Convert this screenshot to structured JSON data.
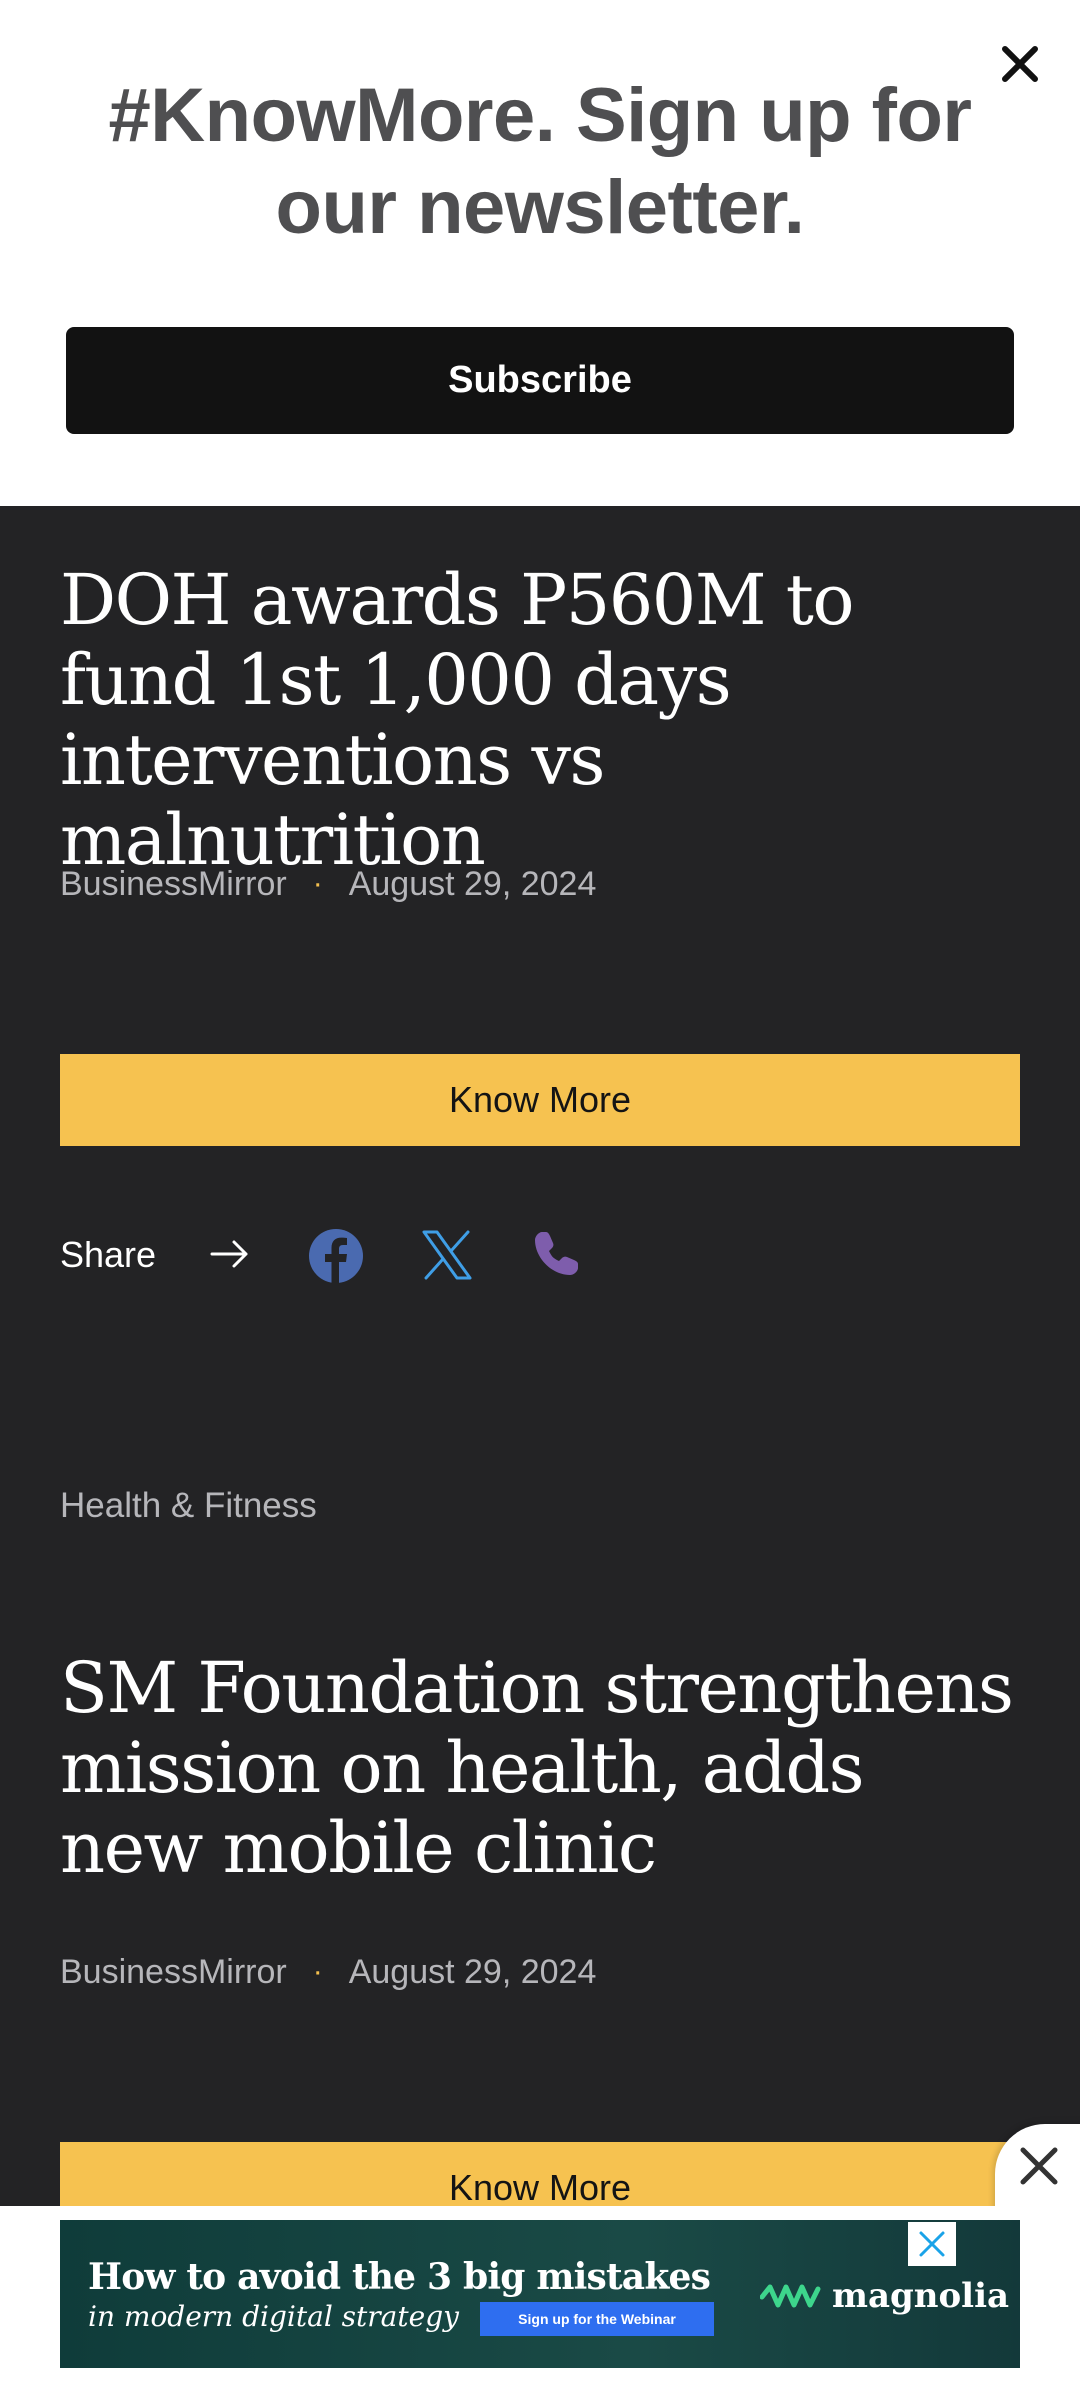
{
  "newsletter": {
    "title": "#KnowMore. Sign up for our newsletter.",
    "subscribe_label": "Subscribe"
  },
  "articles": [
    {
      "title": "DOH awards P560M to fund 1st 1,000 days interventions vs malnutrition",
      "source": "BusinessMirror",
      "separator": "·",
      "date": "August 29, 2024",
      "button_label": "Know More"
    },
    {
      "category": "Health & Fitness",
      "title": "SM Foundation strengthens mission on health, adds new mobile clinic",
      "source": "BusinessMirror",
      "separator": "·",
      "date": "August 29, 2024",
      "button_label": "Know More"
    }
  ],
  "share": {
    "label": "Share",
    "icons": [
      "arrow-right-icon",
      "facebook-icon",
      "x-twitter-icon",
      "phone-icon"
    ]
  },
  "ad": {
    "headline": "How to avoid the 3 big mistakes",
    "subline": "in modern digital strategy",
    "cta": "Sign up for the Webinar",
    "brand": "magnolia"
  },
  "colors": {
    "background": "#232325",
    "accent": "#f6c250",
    "facebook": "#4a6ab0",
    "x": "#3f9ee6",
    "phone": "#7e5dac"
  }
}
